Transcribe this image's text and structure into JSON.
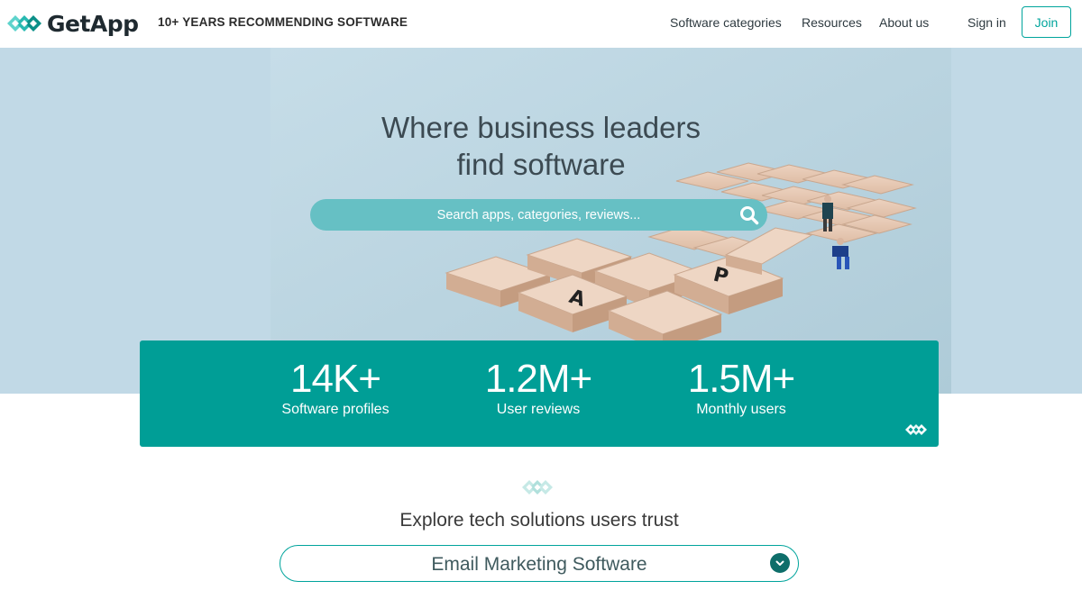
{
  "header": {
    "brand": "GetApp",
    "tagline": "10+ YEARS RECOMMENDING SOFTWARE",
    "nav": {
      "categories": "Software categories",
      "resources": "Resources",
      "about": "About us",
      "signin": "Sign in",
      "join": "Join"
    }
  },
  "hero": {
    "title_line1": "Where business leaders",
    "title_line2": "find software",
    "search_placeholder": "Search apps, categories, reviews...",
    "search_icon": "search-icon",
    "tile_letters": [
      "A",
      "P"
    ]
  },
  "stats": [
    {
      "value": "14K+",
      "label": "Software profiles"
    },
    {
      "value": "1.2M+",
      "label": "User reviews"
    },
    {
      "value": "1.5M+",
      "label": "Monthly users"
    }
  ],
  "explore": {
    "title": "Explore tech solutions users trust",
    "selected": "Email Marketing Software"
  },
  "colors": {
    "accent": "#00a49c",
    "stats_bg": "#009e96",
    "hero_bg": "#c1d9e6",
    "search_bg": "#66c0c4"
  }
}
